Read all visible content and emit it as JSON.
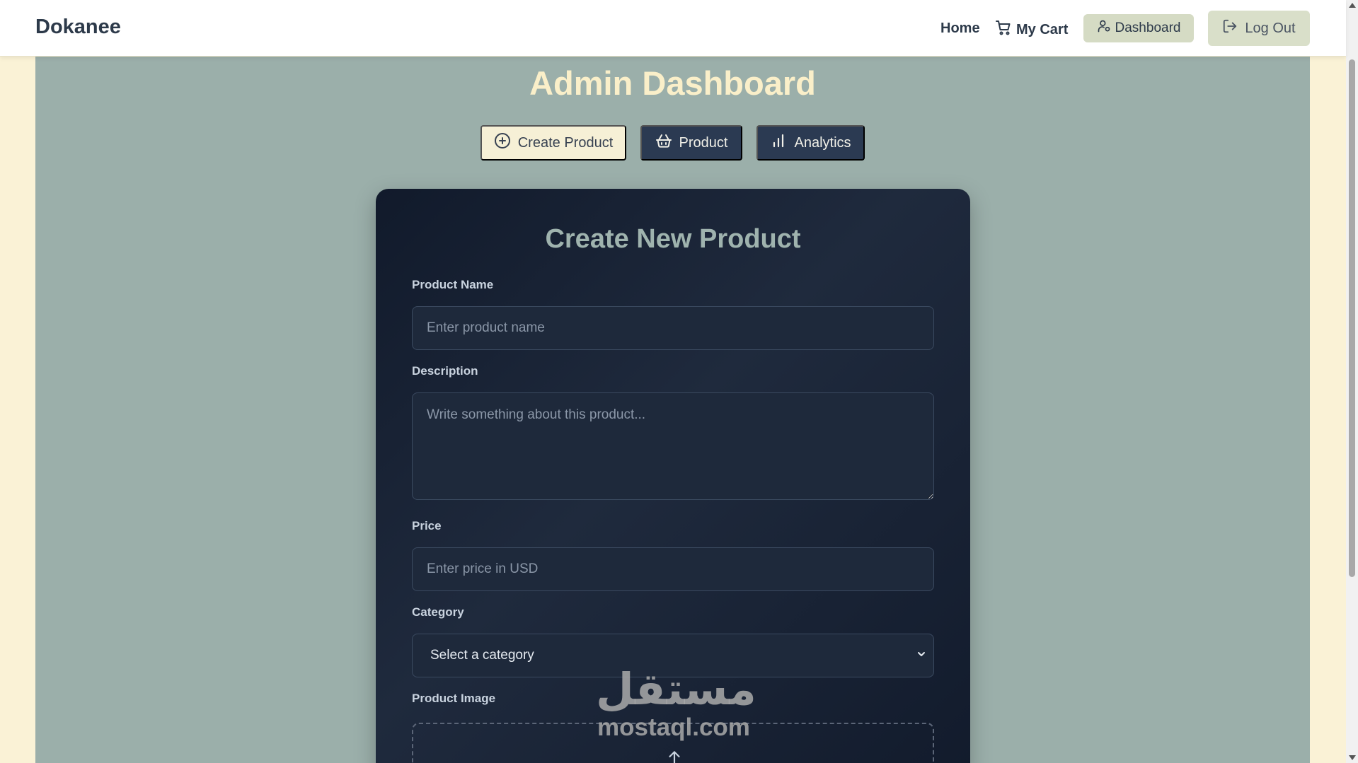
{
  "brand": "Dokanee",
  "nav": {
    "home": "Home",
    "cart": "My Cart",
    "dashboard": "Dashboard",
    "logout": "Log Out"
  },
  "page_title": "Admin Dashboard",
  "tabs": [
    {
      "label": "Create Product",
      "icon": "plus-circle-icon",
      "active": true
    },
    {
      "label": "Product",
      "icon": "basket-icon",
      "active": false
    },
    {
      "label": "Analytics",
      "icon": "bar-chart-icon",
      "active": false
    }
  ],
  "form": {
    "title": "Create New Product",
    "name_label": "Product Name",
    "name_placeholder": "Enter product name",
    "description_label": "Description",
    "description_placeholder": "Write something about this product...",
    "price_label": "Price",
    "price_placeholder": "Enter price in USD",
    "category_label": "Category",
    "category_selected": "Select a category",
    "image_label": "Product Image"
  },
  "watermark": {
    "arabic": "مستقل",
    "latin": "mostaql.com"
  },
  "colors": {
    "page_bg": "#faf2d6",
    "main_bg": "#9bafaa",
    "title": "#faefc9",
    "card_bg": "#1a2436",
    "active_tab": "#f6f0d6",
    "tab": "#2b3a52",
    "nav_button": "#d5dbc4"
  }
}
